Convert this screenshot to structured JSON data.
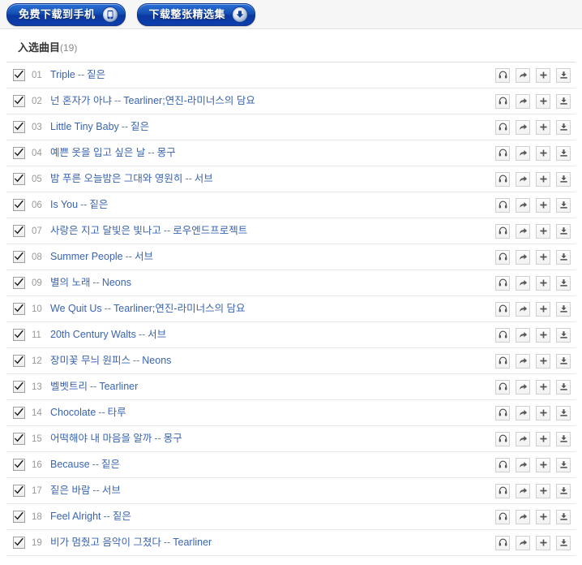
{
  "toolbar": {
    "buttons": [
      {
        "label": "免费下载到手机",
        "icon": "mobile-phone-icon"
      },
      {
        "label": "下载整张精选集",
        "icon": "download-circle-icon"
      }
    ]
  },
  "section": {
    "title": "入选曲目",
    "count": "(19)"
  },
  "row_actions": [
    {
      "name": "listen-icon",
      "title": "试听"
    },
    {
      "name": "share-icon",
      "title": "分享"
    },
    {
      "name": "add-icon",
      "title": "添加"
    },
    {
      "name": "download-icon",
      "title": "下载"
    }
  ],
  "separator": "--",
  "tracks": [
    {
      "num": "01",
      "title": "Triple",
      "artist": "짙은"
    },
    {
      "num": "02",
      "title": "넌 혼자가 아냐",
      "artist": "Tearliner;연진-라미너스의 담요"
    },
    {
      "num": "03",
      "title": "Little Tiny Baby",
      "artist": "짙은"
    },
    {
      "num": "04",
      "title": "예쁜 옷을 입고 싶은 날",
      "artist": "몽구"
    },
    {
      "num": "05",
      "title": "밤 푸른 오늘밤은 그대와 영원히",
      "artist": "서브"
    },
    {
      "num": "06",
      "title": "Is You",
      "artist": "짙은"
    },
    {
      "num": "07",
      "title": "사랑은 지고 달빛은 빛나고",
      "artist": "로우엔드프로젝트"
    },
    {
      "num": "08",
      "title": "Summer People",
      "artist": "서브"
    },
    {
      "num": "09",
      "title": "별의 노래",
      "artist": "Neons"
    },
    {
      "num": "10",
      "title": "We Quit Us",
      "artist": "Tearliner;연진-라미너스의 담요"
    },
    {
      "num": "11",
      "title": "20th Century Walts",
      "artist": "서브"
    },
    {
      "num": "12",
      "title": "장미꽃 무늬 원피스",
      "artist": "Neons"
    },
    {
      "num": "13",
      "title": "벨벳트리",
      "artist": "Tearliner"
    },
    {
      "num": "14",
      "title": "Chocolate",
      "artist": "타루"
    },
    {
      "num": "15",
      "title": "어떡해야 내 마음을 알까",
      "artist": "몽구"
    },
    {
      "num": "16",
      "title": "Because",
      "artist": "짙은"
    },
    {
      "num": "17",
      "title": "짙은 바람",
      "artist": "서브"
    },
    {
      "num": "18",
      "title": "Feel Alright",
      "artist": "짙은"
    },
    {
      "num": "19",
      "title": "비가 멈췄고 음악이 그쳤다",
      "artist": "Tearliner"
    }
  ],
  "colors": {
    "link": "#3a64b0",
    "button_blue": "#0d3fae",
    "number_gray": "#999999"
  }
}
